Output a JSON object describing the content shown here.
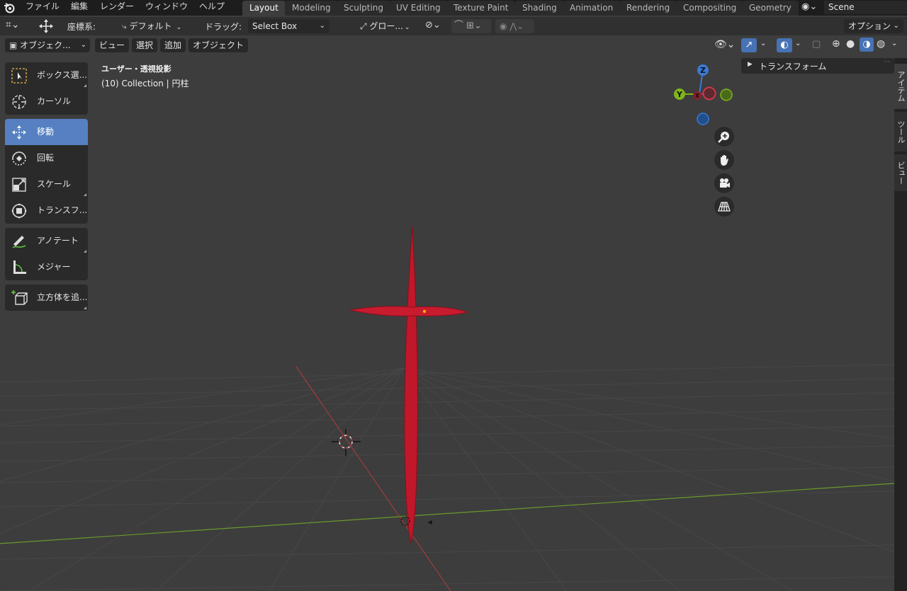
{
  "topbar": {
    "menus": [
      "ファイル",
      "編集",
      "レンダー",
      "ウィンドウ",
      "ヘルプ"
    ],
    "workspace_tabs": [
      "Layout",
      "Modeling",
      "Sculpting",
      "UV Editing",
      "Texture Paint",
      "Shading",
      "Animation",
      "Rendering",
      "Compositing",
      "Geometry"
    ],
    "active_tab": "Layout",
    "scene_name": "Scene"
  },
  "tool_header": {
    "orientation_label": "座標系:",
    "orientation_value": "デフォルト",
    "drag_label": "ドラッグ:",
    "drag_value": "Select Box",
    "pivot_value": "グロー...",
    "options_label": "オプション"
  },
  "viewport_header": {
    "mode": "オブジェク...",
    "menus": [
      "ビュー",
      "選択",
      "追加",
      "オブジェクト"
    ]
  },
  "tools": [
    {
      "label": "ボックス選...",
      "icon": "box-select-icon"
    },
    {
      "label": "カーソル",
      "icon": "cursor-icon"
    },
    {
      "label": "移動",
      "icon": "move-icon",
      "active": true
    },
    {
      "label": "回転",
      "icon": "rotate-icon"
    },
    {
      "label": "スケール",
      "icon": "scale-icon"
    },
    {
      "label": "トランスフ...",
      "icon": "transform-icon"
    },
    {
      "label": "アノテート",
      "icon": "annotate-icon"
    },
    {
      "label": "メジャー",
      "icon": "measure-icon"
    },
    {
      "label": "立方体を追...",
      "icon": "add-cube-icon"
    }
  ],
  "viewport": {
    "view_name": "ユーザー・透視投影",
    "collection_info": "(10) Collection | 円柱"
  },
  "gizmo": {
    "z": "Z",
    "y": "Y",
    "x": "X"
  },
  "npanel": {
    "transform_label": "トランスフォーム"
  },
  "side_tabs": [
    "アイテム",
    "ツール",
    "ビュー"
  ],
  "colors": {
    "accent": "#4772b3",
    "object": "#c0182a",
    "x_axis": "#a33b3b",
    "y_axis": "#6a9a2a"
  }
}
